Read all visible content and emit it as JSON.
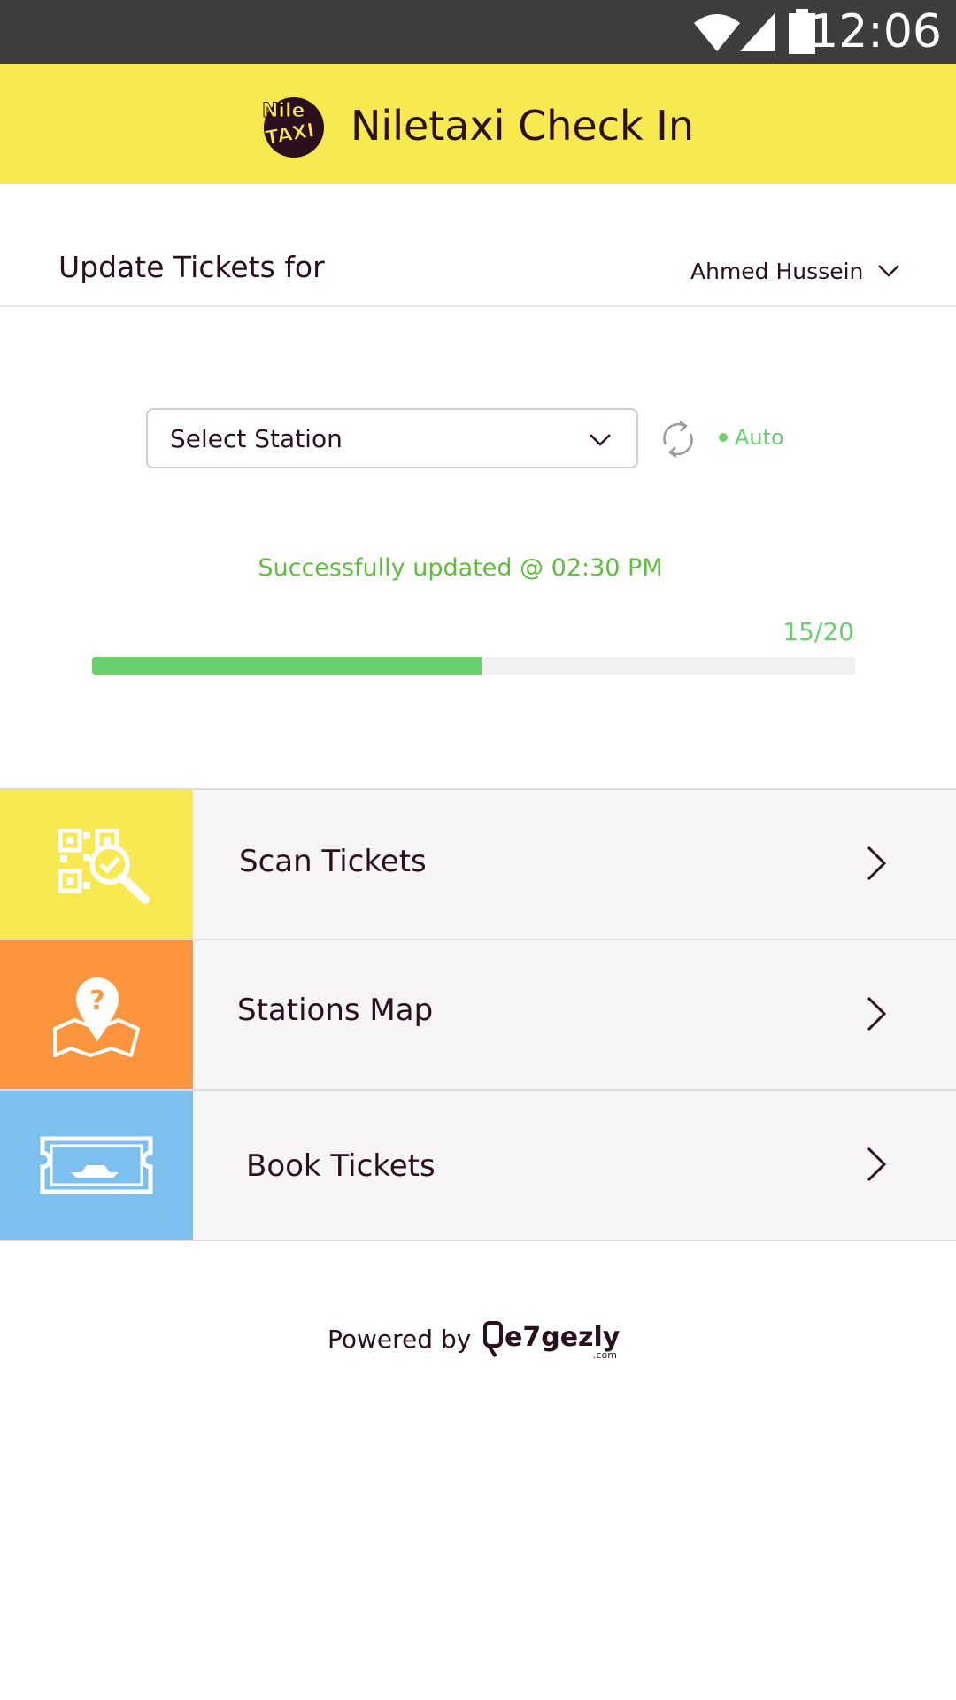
{
  "status_bar": {
    "time": "12:06",
    "icons": [
      "wifi-icon",
      "signal-icon",
      "battery-icon"
    ]
  },
  "app_bar": {
    "title": "Niletaxi Check In",
    "logo_text": [
      "Nile",
      "TAXI"
    ],
    "background": "#f7e94f"
  },
  "update": {
    "label": "Update Tickets for",
    "user": "Ahmed Hussein"
  },
  "station": {
    "placeholder": "Select Station",
    "auto_label": "Auto"
  },
  "sync": {
    "message": "Successfully updated @ 02:30 PM",
    "count_text": "15/20",
    "progress_percent": 51,
    "color": "#6ccf6e"
  },
  "menu": {
    "items": [
      {
        "label": "Scan Tickets",
        "icon": "qr-scan-icon",
        "color": "#f7e94f"
      },
      {
        "label": "Stations Map",
        "icon": "map-question-icon",
        "color": "#fd953e"
      },
      {
        "label": "Book Tickets",
        "icon": "boat-ticket-icon",
        "color": "#7cc0f0"
      }
    ]
  },
  "footer": {
    "powered_by": "Powered by",
    "brand": "e7gezly",
    "brand_suffix": ".com"
  }
}
